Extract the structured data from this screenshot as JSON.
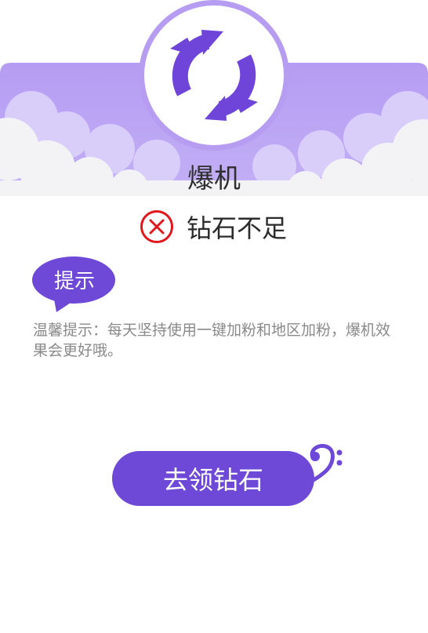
{
  "header": {
    "title": "爆机",
    "logo_icon": "refresh-icon"
  },
  "status": {
    "icon": "close-circle-icon",
    "text": "钻石不足"
  },
  "tip": {
    "label": "提示",
    "text": "温馨提示：每天坚持使用一键加粉和地区加粉，爆机效果会更好哦。"
  },
  "action": {
    "button_label": "去领钻石",
    "decor_icon": "bass-clef-icon"
  },
  "colors": {
    "accent": "#6e48d6",
    "banner": "#b8a1f2",
    "error": "#e0171c"
  }
}
